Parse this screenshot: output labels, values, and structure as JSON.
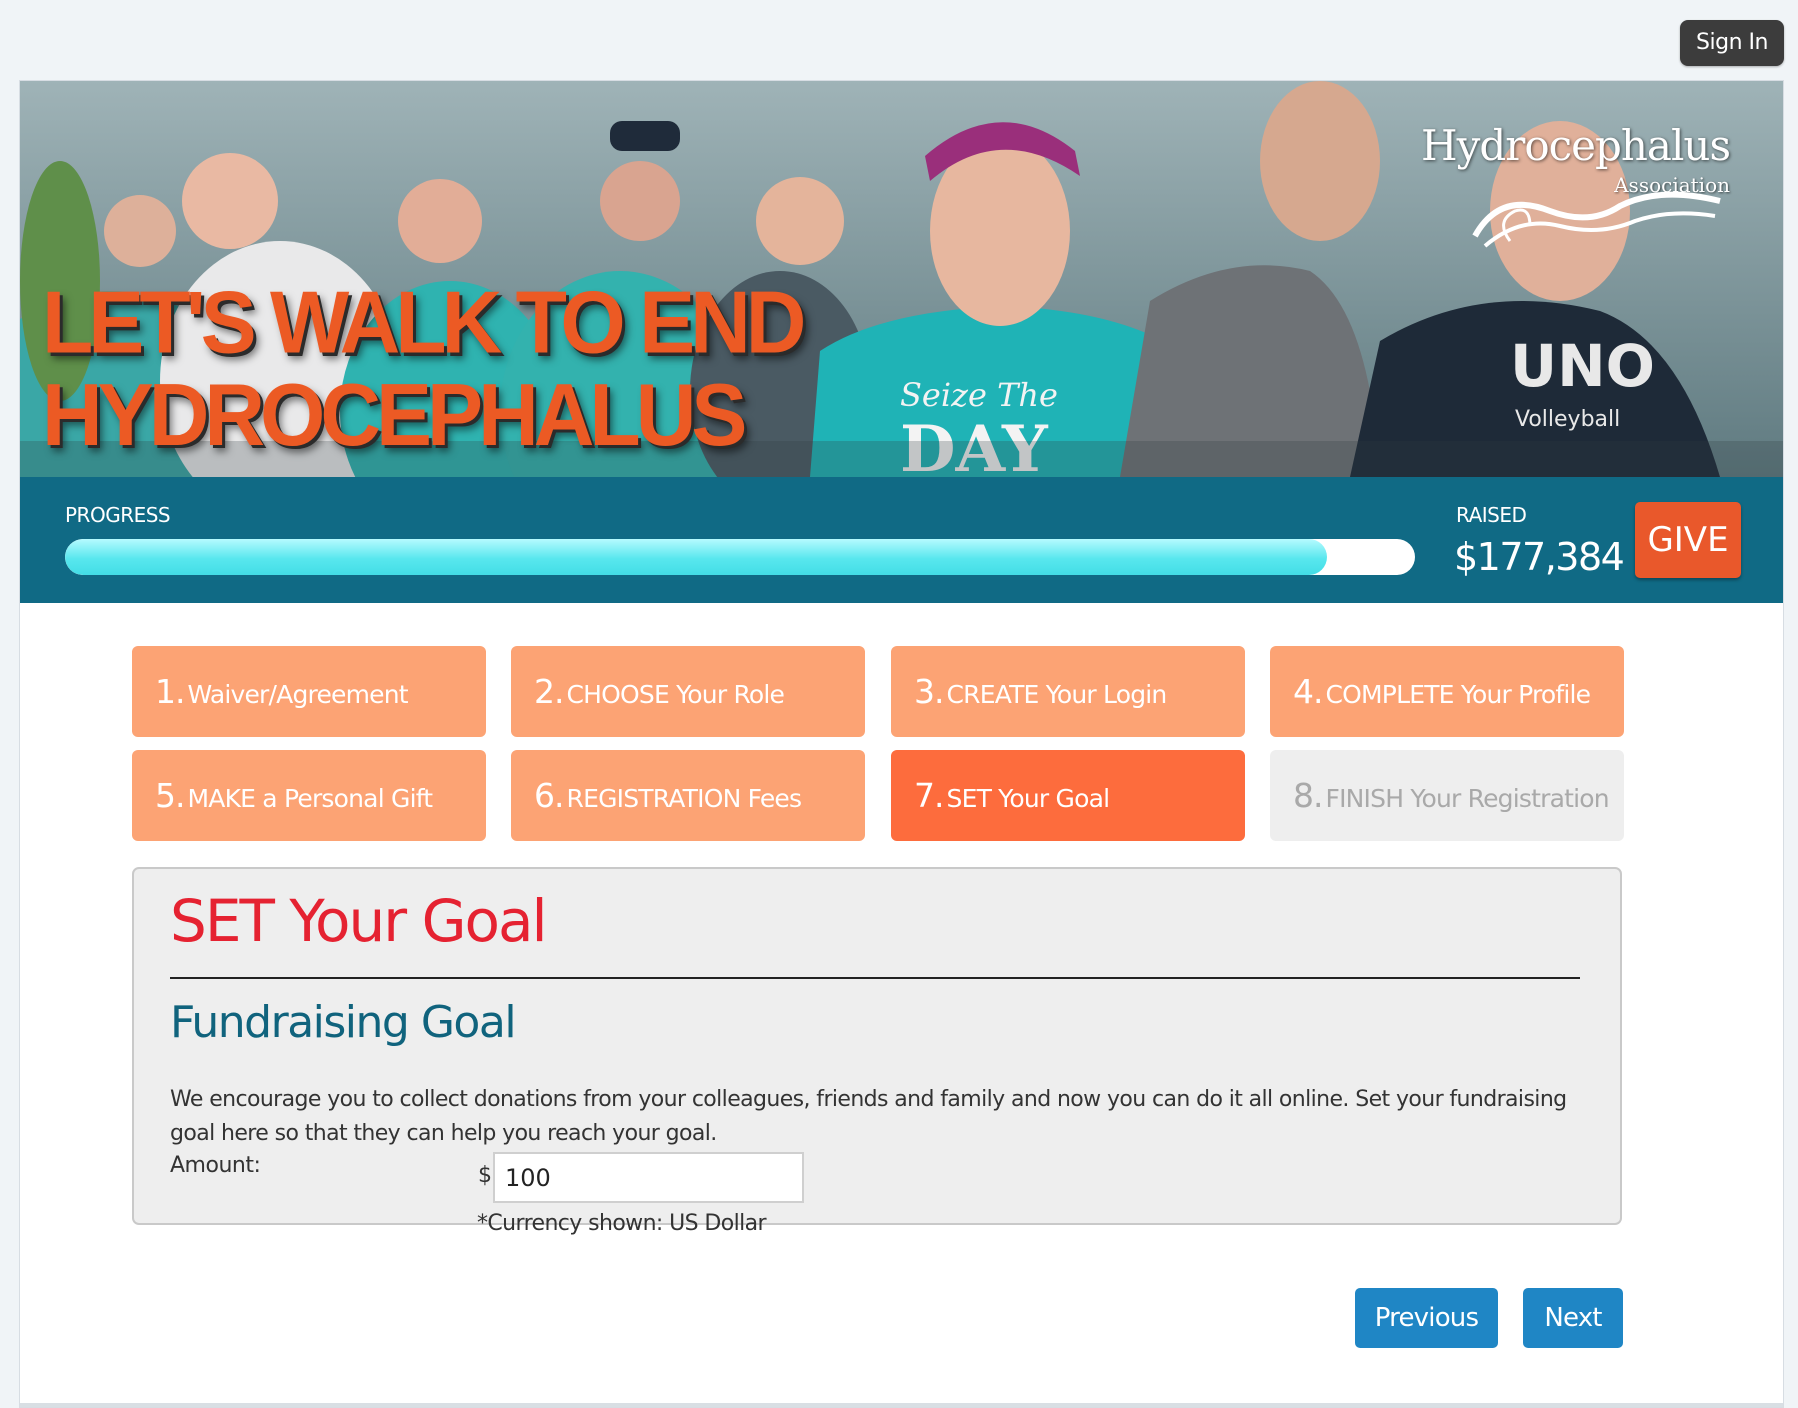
{
  "header": {
    "sign_in_label": "Sign In"
  },
  "banner": {
    "headline_line1": "LET'S WALK TO END",
    "headline_line2": "HYDROCEPHALUS",
    "logo_name": "Hydrocephalus",
    "logo_sub": "Association"
  },
  "progress": {
    "label": "PROGRESS",
    "percent": 93.5,
    "raised_label": "RAISED",
    "raised_value": "$177,384",
    "give_label": "GIVE"
  },
  "steps": [
    {
      "num": "1.",
      "label": "Waiver/Agreement",
      "state": "complete"
    },
    {
      "num": "2.",
      "label": "CHOOSE Your Role",
      "state": "complete"
    },
    {
      "num": "3.",
      "label": "CREATE Your Login",
      "state": "complete"
    },
    {
      "num": "4.",
      "label": "COMPLETE Your Profile",
      "state": "complete"
    },
    {
      "num": "5.",
      "label": "MAKE a Personal Gift",
      "state": "complete"
    },
    {
      "num": "6.",
      "label": "REGISTRATION Fees",
      "state": "complete"
    },
    {
      "num": "7.",
      "label": "SET Your Goal",
      "state": "active"
    },
    {
      "num": "8.",
      "label": "FINISH Your Registration",
      "state": "disabled"
    }
  ],
  "goal": {
    "title": "SET Your Goal",
    "subtitle": "Fundraising Goal",
    "description": "We encourage you to collect donations from your colleagues, friends and family and now you can do it all online. Set your fundraising goal here so that they can help you reach your goal.",
    "amount_label": "Amount:",
    "currency_symbol": "$",
    "amount_value": "100",
    "currency_note": "*Currency shown: US Dollar"
  },
  "nav": {
    "previous_label": "Previous",
    "next_label": "Next"
  },
  "colors": {
    "page_bg": "#f0f4f7",
    "progress_strip": "#106a85",
    "progress_fill": "#58e7ee",
    "give_button": "#e9582b",
    "step_complete": "#fca374",
    "step_active": "#fd6c3d",
    "step_disabled": "#eeeeee",
    "goal_title": "#e52231",
    "goal_subtitle": "#10637d",
    "nav_button": "#1f86c5",
    "headline": "#ec5a24"
  }
}
